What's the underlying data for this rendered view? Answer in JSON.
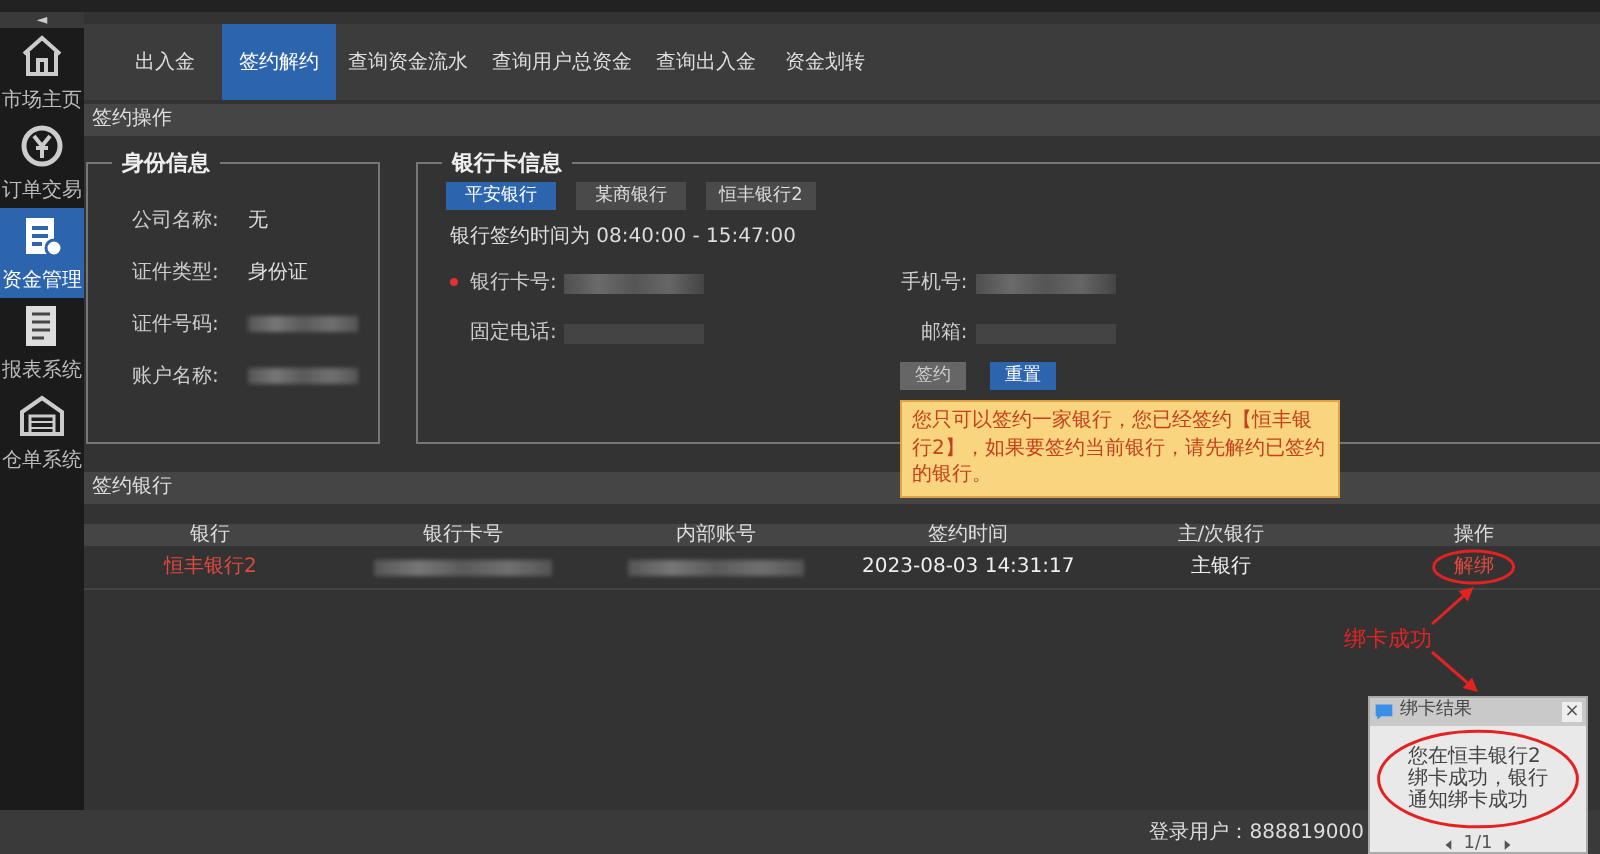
{
  "sidebar": {
    "toggle": "◄",
    "items": [
      {
        "label": "市场主页",
        "selected": false
      },
      {
        "label": "订单交易",
        "selected": false
      },
      {
        "label": "资金管理",
        "selected": true
      },
      {
        "label": "报表系统",
        "selected": false
      },
      {
        "label": "仓单系统",
        "selected": false
      }
    ]
  },
  "tabs": [
    {
      "label": "出入金",
      "selected": false
    },
    {
      "label": "签约解约",
      "selected": true
    },
    {
      "label": "查询资金流水",
      "selected": false
    },
    {
      "label": "查询用户总资金",
      "selected": false
    },
    {
      "label": "查询出入金",
      "selected": false
    },
    {
      "label": "资金划转",
      "selected": false
    }
  ],
  "sign_section": {
    "title": "签约操作",
    "identity": {
      "title": "身份信息",
      "fields": [
        {
          "label": "公司名称:",
          "kind": "text",
          "value": "无"
        },
        {
          "label": "证件类型:",
          "kind": "text",
          "value": "身份证"
        },
        {
          "label": "证件号码:",
          "kind": "masked"
        },
        {
          "label": "账户名称:",
          "kind": "masked"
        }
      ]
    },
    "bank_card": {
      "title": "银行卡信息",
      "banks": [
        {
          "label": "平安银行",
          "selected": true
        },
        {
          "label": "某商银行",
          "selected": false
        },
        {
          "label": "恒丰银行2",
          "selected": false
        }
      ],
      "time_note": "银行签约时间为 08:40:00 - 15:47:00",
      "fields": [
        {
          "label": "银行卡号:",
          "required": true,
          "kind": "masked"
        },
        {
          "label": "手机号:",
          "required": false,
          "kind": "masked"
        },
        {
          "label": "固定电话:",
          "required": false,
          "kind": "empty"
        },
        {
          "label": "邮箱:",
          "required": false,
          "kind": "empty"
        }
      ],
      "buttons": [
        {
          "label": "签约",
          "disabled": true
        },
        {
          "label": "重置",
          "disabled": false
        }
      ],
      "tooltip": "您只可以签约一家银行，您已经签约【恒丰银行2】，如果要签约当前银行，请先解约已签约的银行。"
    }
  },
  "signed_banks": {
    "title": "签约银行",
    "columns": [
      "银行",
      "银行卡号",
      "内部账号",
      "签约时间",
      "主/次银行",
      "操作"
    ],
    "rows": [
      {
        "cells": [
          {
            "kind": "highlight",
            "text": "恒丰银行2"
          },
          {
            "kind": "masked"
          },
          {
            "kind": "masked"
          },
          {
            "kind": "text",
            "text": "2023-08-03 14:31:17"
          },
          {
            "kind": "text",
            "text": "主银行"
          },
          {
            "kind": "link",
            "text": "解绑"
          }
        ]
      }
    ]
  },
  "annotation": {
    "label": "绑卡成功"
  },
  "notification": {
    "title": "绑卡结果",
    "close": "×",
    "message": "您在恒丰银行2绑卡成功，银行通知绑卡成功",
    "pager": "1/1"
  },
  "status_bar": {
    "text": "登录用户：888819000"
  }
}
